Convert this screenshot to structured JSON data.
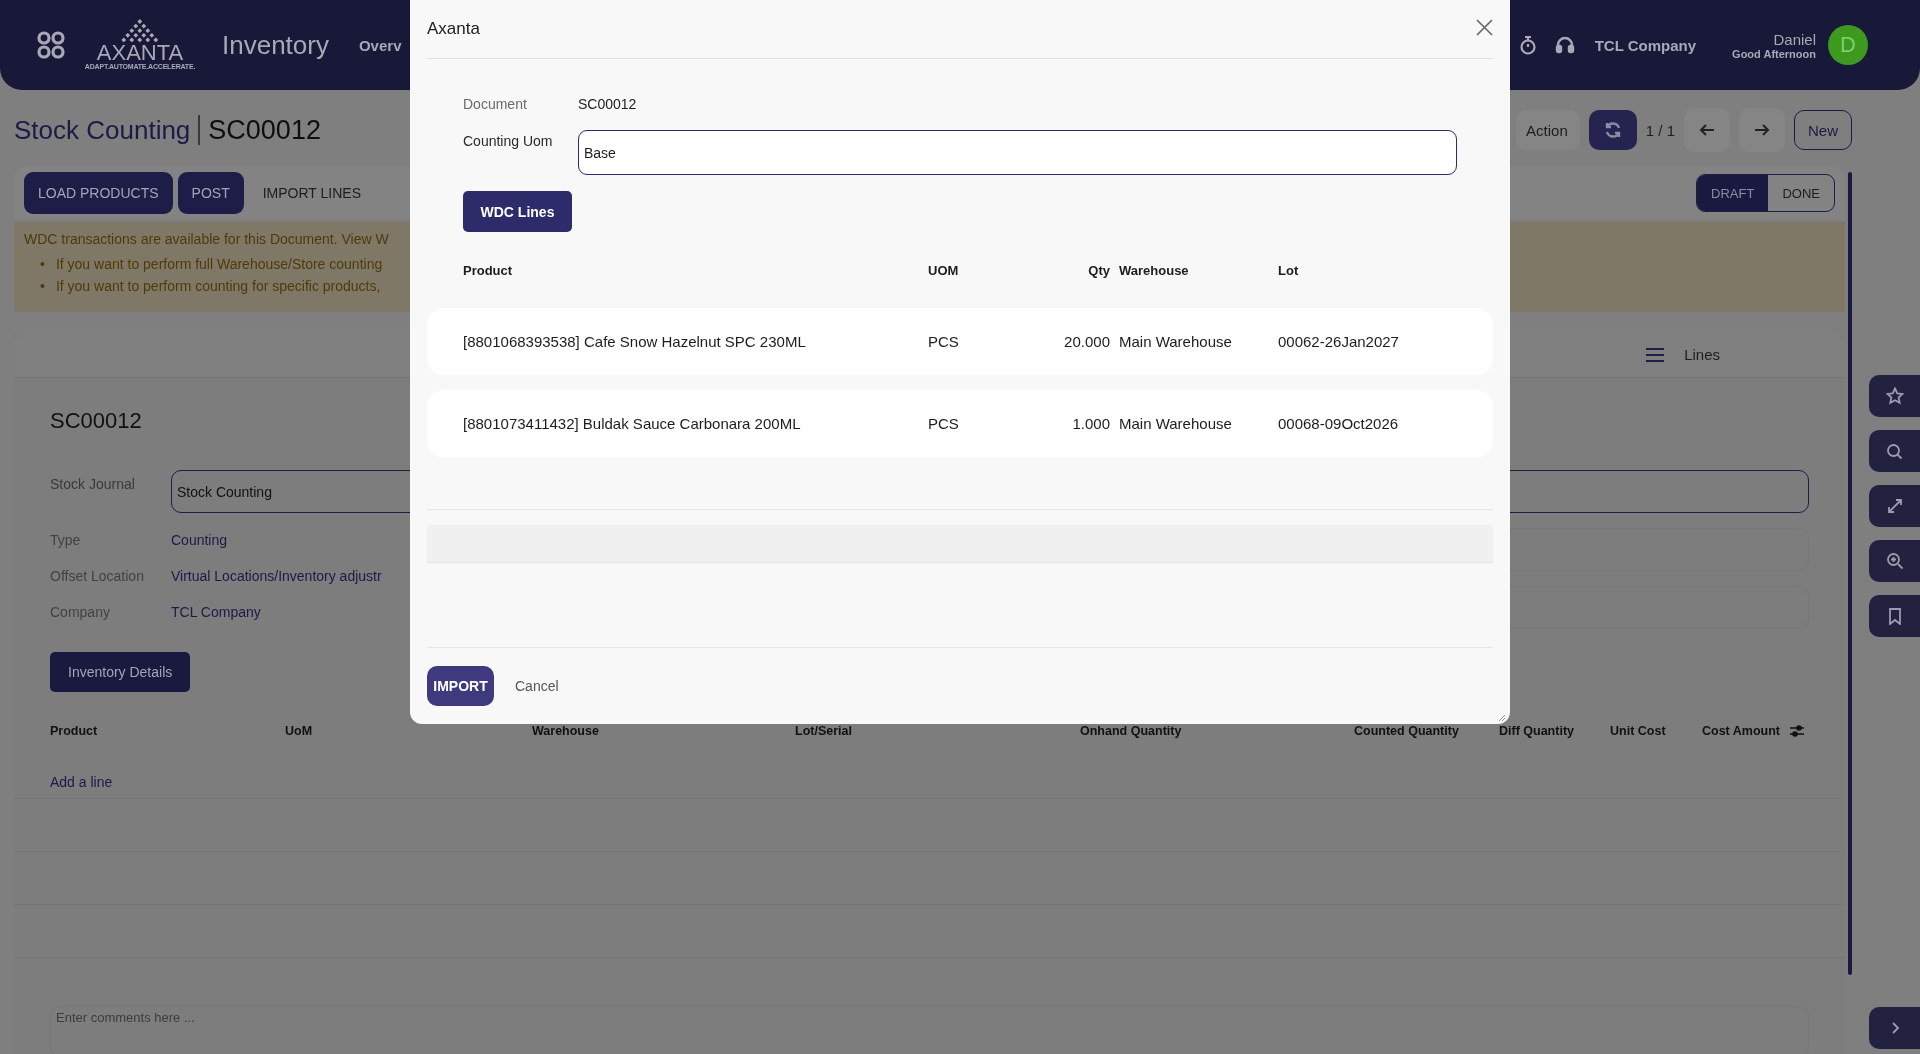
{
  "header": {
    "logo": "AXANTA",
    "tagline": "ADAPT.AUTOMATE.ACCELERATE.",
    "app_title": "Inventory",
    "menu": [
      "Overv"
    ],
    "company": "TCL Company",
    "user_name": "Daniel",
    "greeting": "Good Afternoon",
    "avatar_initial": "D"
  },
  "breadcrumb": {
    "parent": "Stock Counting",
    "current": "SC00012"
  },
  "toolbar": {
    "action": "Action",
    "pager": "1 / 1",
    "new": "New"
  },
  "actions": [
    {
      "label": "LOAD PRODUCTS",
      "kind": "primary"
    },
    {
      "label": "POST",
      "kind": "primary"
    },
    {
      "label": "IMPORT LINES",
      "kind": "link"
    }
  ],
  "statuses": [
    {
      "label": "DRAFT",
      "selected": true
    },
    {
      "label": "DONE",
      "selected": false
    }
  ],
  "alert": {
    "text": "WDC transactions are available for this Document. View W",
    "bullets": [
      {
        "marker": "•",
        "text": "If you want to perform full Warehouse/Store counting"
      },
      {
        "marker": "•",
        "text": "If you want to perform counting for specific products,"
      }
    ]
  },
  "record": {
    "tab": "Lines",
    "title": "SC00012",
    "fields": [
      {
        "label": "Stock Journal",
        "value": "Stock Counting",
        "kind": "input"
      },
      {
        "label": "Type",
        "value": "Counting",
        "kind": "text"
      },
      {
        "label": "Offset Location",
        "value": "Virtual Locations/Inventory adjustr",
        "kind": "text"
      },
      {
        "label": "Company",
        "value": "TCL Company",
        "kind": "text"
      }
    ],
    "button": "Inventory Details",
    "columns": [
      "Product",
      "UoM",
      "Warehouse",
      "Lot/Serial",
      "Onhand Quantity",
      "Counted Quantity",
      "Diff Quantity",
      "Unit Cost",
      "Cost Amount"
    ],
    "add_line": "Add a line",
    "comments_placeholder": "Enter comments here ..."
  },
  "dialog": {
    "title": "Axanta",
    "document_label": "Document",
    "document_value": "SC00012",
    "uom_label": "Counting Uom",
    "uom_value": "Base",
    "wdc_button": "WDC Lines",
    "columns": [
      "Product",
      "UOM",
      "Qty",
      "Warehouse",
      "Lot"
    ],
    "lines": [
      {
        "product": "[8801068393538] Cafe Snow Hazelnut SPC 230ML",
        "uom": "PCS",
        "qty": "20.000",
        "warehouse": "Main Warehouse",
        "lot": "00062-26Jan2027"
      },
      {
        "product": "[8801073411432] Buldak Sauce Carbonara 200ML",
        "uom": "PCS",
        "qty": "1.000",
        "warehouse": "Main Warehouse",
        "lot": "00068-09Oct2026"
      }
    ],
    "import_button": "IMPORT",
    "cancel_button": "Cancel"
  }
}
